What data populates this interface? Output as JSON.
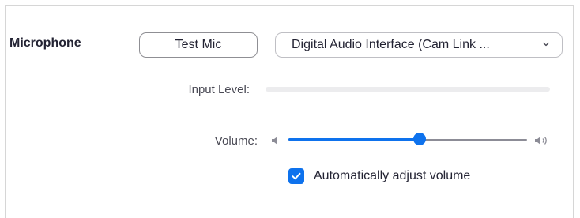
{
  "microphone": {
    "section_label": "Microphone",
    "test_button_label": "Test Mic",
    "device_selected": "Digital Audio Interface (Cam Link ...",
    "input_level_label": "Input Level:",
    "input_level": 0,
    "volume_label": "Volume:",
    "volume_level": 0.55,
    "auto_adjust_label": "Automatically adjust volume",
    "auto_adjust_checked": true
  },
  "icons": {
    "dropdown": "chevron-down-icon",
    "volume_low": "speaker-low-icon",
    "volume_high": "speaker-high-icon",
    "checkbox": "checkmark-icon"
  },
  "colors": {
    "accent": "#0e72ed",
    "text": "#232333",
    "muted_text": "#4a4a55",
    "level_track": "#ececee"
  }
}
